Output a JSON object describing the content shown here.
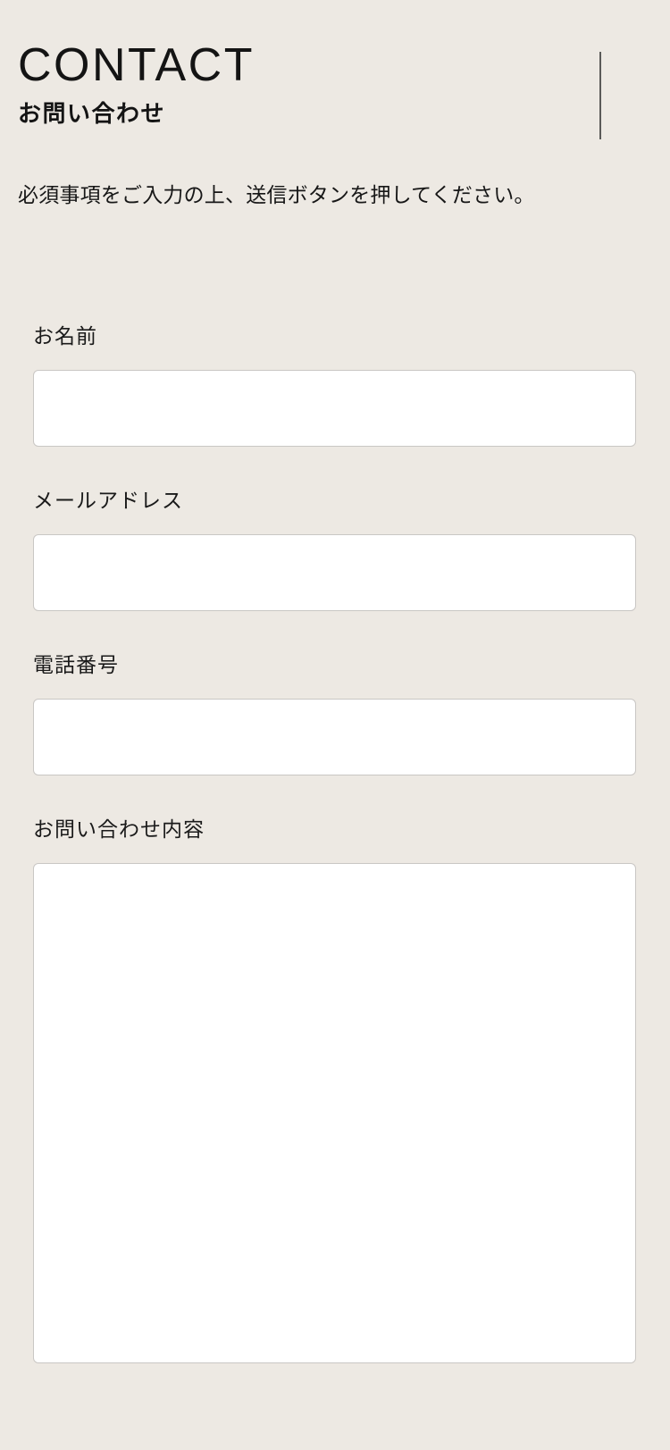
{
  "header": {
    "title": "CONTACT",
    "subtitle": "お問い合わせ",
    "rule": "vertical-rule"
  },
  "lead": {
    "text": "必須事項をご入力の上、送信ボタンを押してください。"
  },
  "form": {
    "fields": [
      {
        "name": "name",
        "label": "お名前",
        "value": "",
        "placeholder": "",
        "type": "text"
      },
      {
        "name": "email",
        "label": "メールアドレス",
        "value": "",
        "placeholder": "",
        "type": "email"
      },
      {
        "name": "tel",
        "label": "電話番号",
        "value": "",
        "placeholder": "",
        "type": "tel"
      },
      {
        "name": "message",
        "label": "お問い合わせ内容",
        "value": "",
        "placeholder": "",
        "type": "textarea"
      }
    ]
  },
  "colors": {
    "background": "#EDE9E3",
    "text": "#141414",
    "field_background": "#FFFFFF",
    "field_border": "#C9C7C4",
    "rule": "#5A5A58"
  }
}
